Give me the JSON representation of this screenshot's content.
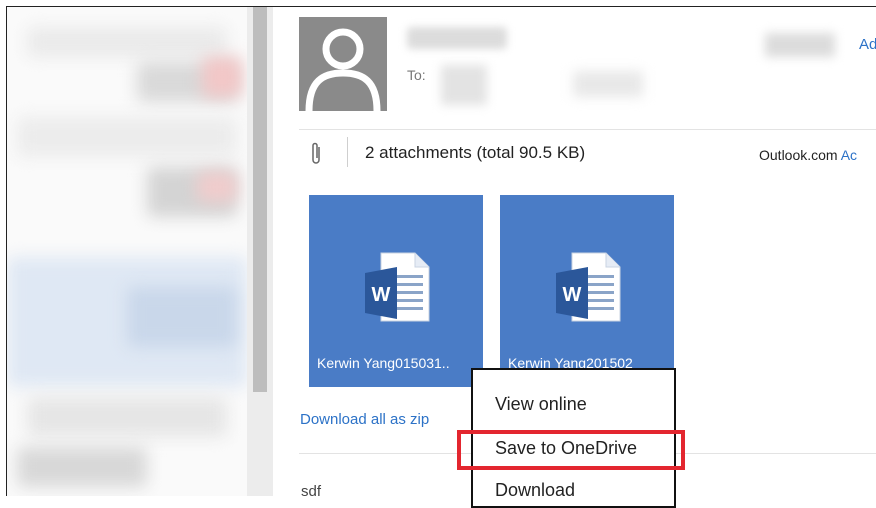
{
  "email": {
    "to_label": "To:",
    "header_link": "Ad",
    "attachments_summary": "2 attachments (total 90.5 KB)",
    "outlook_label": "Outlook.com",
    "outlook_link": "Ac",
    "download_all": "Download all as zip",
    "body_preview": "sdf"
  },
  "attachments": [
    {
      "name": "Kerwin Yang015031..",
      "icon": "word-document-icon"
    },
    {
      "name": "Kerwin Yang201502",
      "icon": "word-document-icon"
    }
  ],
  "context_menu": {
    "items": [
      "View online",
      "Save to OneDrive",
      "Download"
    ],
    "highlighted_item": "Save to OneDrive"
  },
  "colors": {
    "tile": "#4a7cc6",
    "link": "#2c72c7",
    "highlight": "#e3262f",
    "word_blue": "#2b579a"
  }
}
